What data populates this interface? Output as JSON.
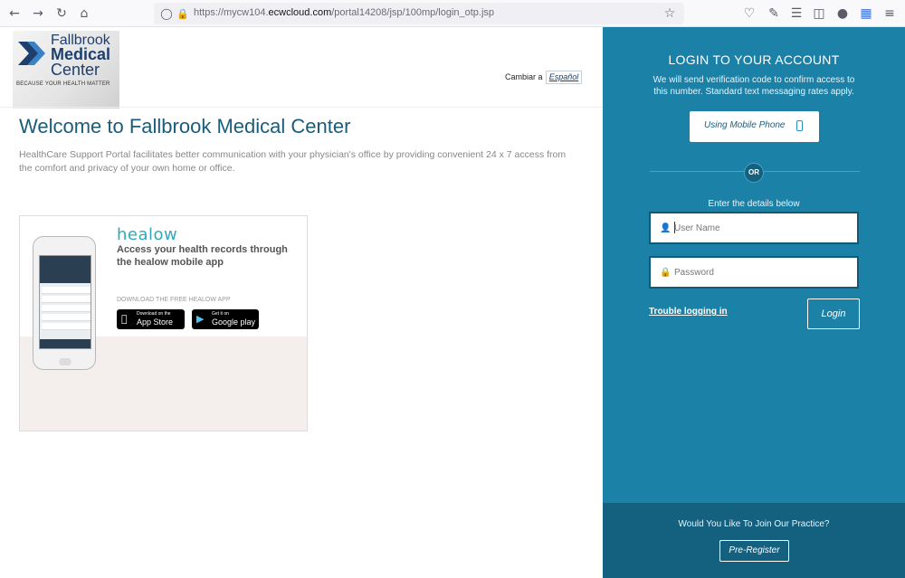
{
  "browser": {
    "url_prefix": "https://mycw104.",
    "url_host": "ecwcloud.com",
    "url_path": "/portal14208/jsp/100mp/login_otp.jsp"
  },
  "logo": {
    "line1": "Fallbrook",
    "line2": "Medical",
    "line3": "Center",
    "tagline": "BECAUSE YOUR HEALTH MATTER"
  },
  "language": {
    "label": "Cambiar a",
    "option": "Español"
  },
  "welcome": {
    "title": "Welcome to Fallbrook Medical Center",
    "description": "HealthCare Support Portal facilitates better communication with your physician's office by providing convenient 24 x 7 access from the comfort and privacy of your own home or office."
  },
  "promo": {
    "brand": "healow",
    "headline": "Access your health records through the healow mobile app",
    "download_label": "DOWNLOAD THE FREE HEALOW APP",
    "appstore_small": "Download on the",
    "appstore_big": "App Store",
    "googleplay_small": "Get it on",
    "googleplay_big": "Google play"
  },
  "login": {
    "title": "LOGIN TO YOUR ACCOUNT",
    "info": "We will send verification code to confirm access to this number. Standard text messaging rates apply.",
    "mobile_button": "Using Mobile Phone",
    "or": "OR",
    "enter_details": "Enter the details below",
    "username_placeholder": "User Name",
    "password_placeholder": "Password",
    "trouble": "Trouble logging in",
    "login_button": "Login"
  },
  "footer": {
    "join_text": "Would You Like To Join Our Practice?",
    "preregister": "Pre-Register"
  },
  "colors": {
    "panel": "#1c81a7",
    "panel_dark": "#13607f",
    "heading": "#1a5c7a",
    "healow": "#31a9b8"
  }
}
